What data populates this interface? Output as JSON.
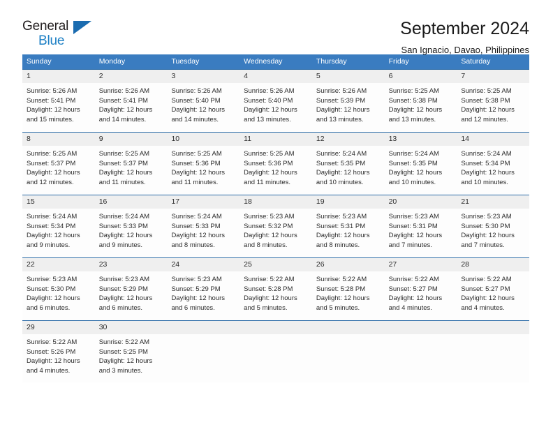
{
  "brand": {
    "name_part1": "General",
    "name_part2": "Blue",
    "accent_color": "#1c7fc4",
    "triangle_color": "#1b6cb0"
  },
  "header": {
    "title": "September 2024",
    "subtitle": "San Ignacio, Davao, Philippines"
  },
  "calendar": {
    "header_bg": "#3a7cc0",
    "row_border_color": "#2e6da8",
    "daynum_band_bg": "#efefef",
    "weekdays": [
      "Sunday",
      "Monday",
      "Tuesday",
      "Wednesday",
      "Thursday",
      "Friday",
      "Saturday"
    ],
    "weeks": [
      {
        "days": [
          {
            "num": "1",
            "lines": [
              "Sunrise: 5:26 AM",
              "Sunset: 5:41 PM",
              "Daylight: 12 hours",
              "and 15 minutes."
            ]
          },
          {
            "num": "2",
            "lines": [
              "Sunrise: 5:26 AM",
              "Sunset: 5:41 PM",
              "Daylight: 12 hours",
              "and 14 minutes."
            ]
          },
          {
            "num": "3",
            "lines": [
              "Sunrise: 5:26 AM",
              "Sunset: 5:40 PM",
              "Daylight: 12 hours",
              "and 14 minutes."
            ]
          },
          {
            "num": "4",
            "lines": [
              "Sunrise: 5:26 AM",
              "Sunset: 5:40 PM",
              "Daylight: 12 hours",
              "and 13 minutes."
            ]
          },
          {
            "num": "5",
            "lines": [
              "Sunrise: 5:26 AM",
              "Sunset: 5:39 PM",
              "Daylight: 12 hours",
              "and 13 minutes."
            ]
          },
          {
            "num": "6",
            "lines": [
              "Sunrise: 5:25 AM",
              "Sunset: 5:38 PM",
              "Daylight: 12 hours",
              "and 13 minutes."
            ]
          },
          {
            "num": "7",
            "lines": [
              "Sunrise: 5:25 AM",
              "Sunset: 5:38 PM",
              "Daylight: 12 hours",
              "and 12 minutes."
            ]
          }
        ]
      },
      {
        "days": [
          {
            "num": "8",
            "lines": [
              "Sunrise: 5:25 AM",
              "Sunset: 5:37 PM",
              "Daylight: 12 hours",
              "and 12 minutes."
            ]
          },
          {
            "num": "9",
            "lines": [
              "Sunrise: 5:25 AM",
              "Sunset: 5:37 PM",
              "Daylight: 12 hours",
              "and 11 minutes."
            ]
          },
          {
            "num": "10",
            "lines": [
              "Sunrise: 5:25 AM",
              "Sunset: 5:36 PM",
              "Daylight: 12 hours",
              "and 11 minutes."
            ]
          },
          {
            "num": "11",
            "lines": [
              "Sunrise: 5:25 AM",
              "Sunset: 5:36 PM",
              "Daylight: 12 hours",
              "and 11 minutes."
            ]
          },
          {
            "num": "12",
            "lines": [
              "Sunrise: 5:24 AM",
              "Sunset: 5:35 PM",
              "Daylight: 12 hours",
              "and 10 minutes."
            ]
          },
          {
            "num": "13",
            "lines": [
              "Sunrise: 5:24 AM",
              "Sunset: 5:35 PM",
              "Daylight: 12 hours",
              "and 10 minutes."
            ]
          },
          {
            "num": "14",
            "lines": [
              "Sunrise: 5:24 AM",
              "Sunset: 5:34 PM",
              "Daylight: 12 hours",
              "and 10 minutes."
            ]
          }
        ]
      },
      {
        "days": [
          {
            "num": "15",
            "lines": [
              "Sunrise: 5:24 AM",
              "Sunset: 5:34 PM",
              "Daylight: 12 hours",
              "and 9 minutes."
            ]
          },
          {
            "num": "16",
            "lines": [
              "Sunrise: 5:24 AM",
              "Sunset: 5:33 PM",
              "Daylight: 12 hours",
              "and 9 minutes."
            ]
          },
          {
            "num": "17",
            "lines": [
              "Sunrise: 5:24 AM",
              "Sunset: 5:33 PM",
              "Daylight: 12 hours",
              "and 8 minutes."
            ]
          },
          {
            "num": "18",
            "lines": [
              "Sunrise: 5:23 AM",
              "Sunset: 5:32 PM",
              "Daylight: 12 hours",
              "and 8 minutes."
            ]
          },
          {
            "num": "19",
            "lines": [
              "Sunrise: 5:23 AM",
              "Sunset: 5:31 PM",
              "Daylight: 12 hours",
              "and 8 minutes."
            ]
          },
          {
            "num": "20",
            "lines": [
              "Sunrise: 5:23 AM",
              "Sunset: 5:31 PM",
              "Daylight: 12 hours",
              "and 7 minutes."
            ]
          },
          {
            "num": "21",
            "lines": [
              "Sunrise: 5:23 AM",
              "Sunset: 5:30 PM",
              "Daylight: 12 hours",
              "and 7 minutes."
            ]
          }
        ]
      },
      {
        "days": [
          {
            "num": "22",
            "lines": [
              "Sunrise: 5:23 AM",
              "Sunset: 5:30 PM",
              "Daylight: 12 hours",
              "and 6 minutes."
            ]
          },
          {
            "num": "23",
            "lines": [
              "Sunrise: 5:23 AM",
              "Sunset: 5:29 PM",
              "Daylight: 12 hours",
              "and 6 minutes."
            ]
          },
          {
            "num": "24",
            "lines": [
              "Sunrise: 5:23 AM",
              "Sunset: 5:29 PM",
              "Daylight: 12 hours",
              "and 6 minutes."
            ]
          },
          {
            "num": "25",
            "lines": [
              "Sunrise: 5:22 AM",
              "Sunset: 5:28 PM",
              "Daylight: 12 hours",
              "and 5 minutes."
            ]
          },
          {
            "num": "26",
            "lines": [
              "Sunrise: 5:22 AM",
              "Sunset: 5:28 PM",
              "Daylight: 12 hours",
              "and 5 minutes."
            ]
          },
          {
            "num": "27",
            "lines": [
              "Sunrise: 5:22 AM",
              "Sunset: 5:27 PM",
              "Daylight: 12 hours",
              "and 4 minutes."
            ]
          },
          {
            "num": "28",
            "lines": [
              "Sunrise: 5:22 AM",
              "Sunset: 5:27 PM",
              "Daylight: 12 hours",
              "and 4 minutes."
            ]
          }
        ]
      },
      {
        "days": [
          {
            "num": "29",
            "lines": [
              "Sunrise: 5:22 AM",
              "Sunset: 5:26 PM",
              "Daylight: 12 hours",
              "and 4 minutes."
            ]
          },
          {
            "num": "30",
            "lines": [
              "Sunrise: 5:22 AM",
              "Sunset: 5:25 PM",
              "Daylight: 12 hours",
              "and 3 minutes."
            ]
          },
          {
            "num": "",
            "lines": []
          },
          {
            "num": "",
            "lines": []
          },
          {
            "num": "",
            "lines": []
          },
          {
            "num": "",
            "lines": []
          },
          {
            "num": "",
            "lines": []
          }
        ]
      }
    ]
  }
}
